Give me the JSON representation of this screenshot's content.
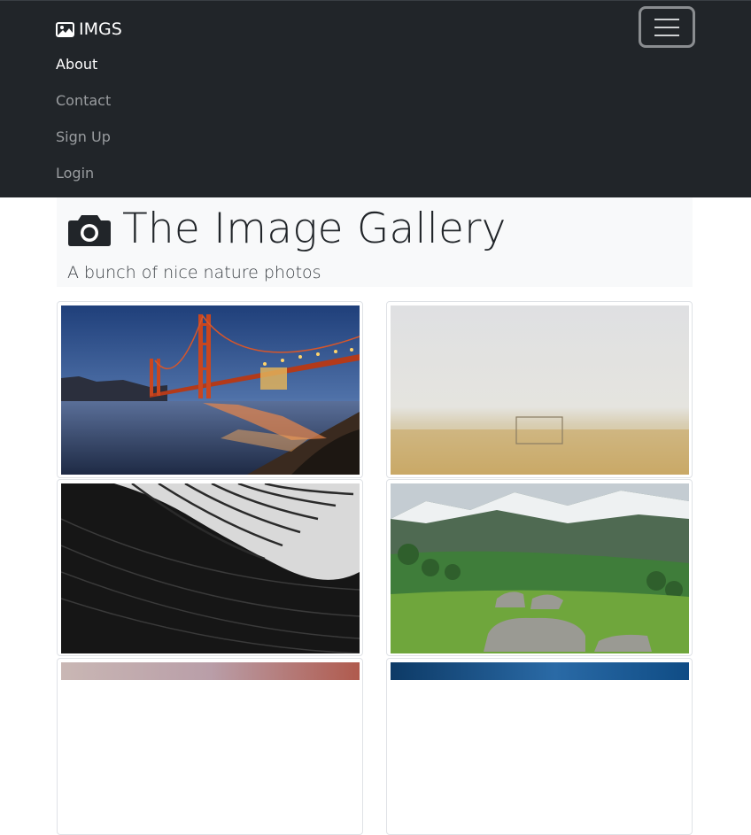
{
  "navbar": {
    "brand": "IMGS",
    "links": [
      {
        "label": "About",
        "active": true
      },
      {
        "label": "Contact",
        "active": false
      },
      {
        "label": "Sign Up",
        "active": false
      },
      {
        "label": "Login",
        "active": false
      }
    ]
  },
  "header": {
    "title": "The Image Gallery",
    "subtitle": "A bunch of nice nature photos"
  },
  "gallery": {
    "photos": [
      {
        "subject": "golden-gate-bridge-at-dusk"
      },
      {
        "subject": "foggy-field-with-goal"
      },
      {
        "subject": "black-and-white-architecture"
      },
      {
        "subject": "mountain-meadow-with-rocks"
      },
      {
        "subject": "sunset-sky-partial"
      },
      {
        "subject": "blue-sky-partial"
      }
    ]
  },
  "colors": {
    "navbar_bg": "#212529",
    "jumbotron_bg": "#f8f9fa",
    "nav_active": "#ffffff",
    "nav_inactive": "#9a9da0"
  }
}
